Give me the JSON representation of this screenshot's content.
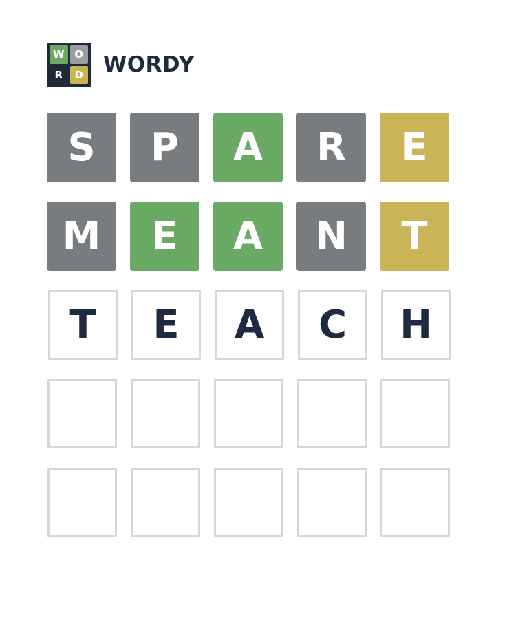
{
  "app": {
    "title": "WORDY",
    "logo": {
      "letters": [
        "W",
        "O",
        "R",
        "D"
      ],
      "colors": [
        "#6aaa64",
        "#9a9ea3",
        "#1f2937",
        "#c9b458"
      ]
    }
  },
  "colors": {
    "correct": "#6aaa64",
    "present": "#c9b458",
    "absent": "#787c7e",
    "empty_border": "#d6d7dc",
    "text_dark": "#1e2a3f"
  },
  "board": {
    "rows": [
      {
        "state": "submitted",
        "tiles": [
          {
            "letter": "S",
            "status": "absent"
          },
          {
            "letter": "P",
            "status": "absent"
          },
          {
            "letter": "A",
            "status": "correct"
          },
          {
            "letter": "R",
            "status": "absent"
          },
          {
            "letter": "E",
            "status": "present"
          }
        ]
      },
      {
        "state": "submitted",
        "tiles": [
          {
            "letter": "M",
            "status": "absent"
          },
          {
            "letter": "E",
            "status": "correct"
          },
          {
            "letter": "A",
            "status": "correct"
          },
          {
            "letter": "N",
            "status": "absent"
          },
          {
            "letter": "T",
            "status": "present"
          }
        ]
      },
      {
        "state": "current",
        "tiles": [
          {
            "letter": "T",
            "status": "pending"
          },
          {
            "letter": "E",
            "status": "pending"
          },
          {
            "letter": "A",
            "status": "pending"
          },
          {
            "letter": "C",
            "status": "pending"
          },
          {
            "letter": "H",
            "status": "pending"
          }
        ]
      },
      {
        "state": "empty",
        "tiles": [
          {
            "letter": "",
            "status": "empty"
          },
          {
            "letter": "",
            "status": "empty"
          },
          {
            "letter": "",
            "status": "empty"
          },
          {
            "letter": "",
            "status": "empty"
          },
          {
            "letter": "",
            "status": "empty"
          }
        ]
      },
      {
        "state": "empty",
        "tiles": [
          {
            "letter": "",
            "status": "empty"
          },
          {
            "letter": "",
            "status": "empty"
          },
          {
            "letter": "",
            "status": "empty"
          },
          {
            "letter": "",
            "status": "empty"
          },
          {
            "letter": "",
            "status": "empty"
          }
        ]
      }
    ]
  }
}
